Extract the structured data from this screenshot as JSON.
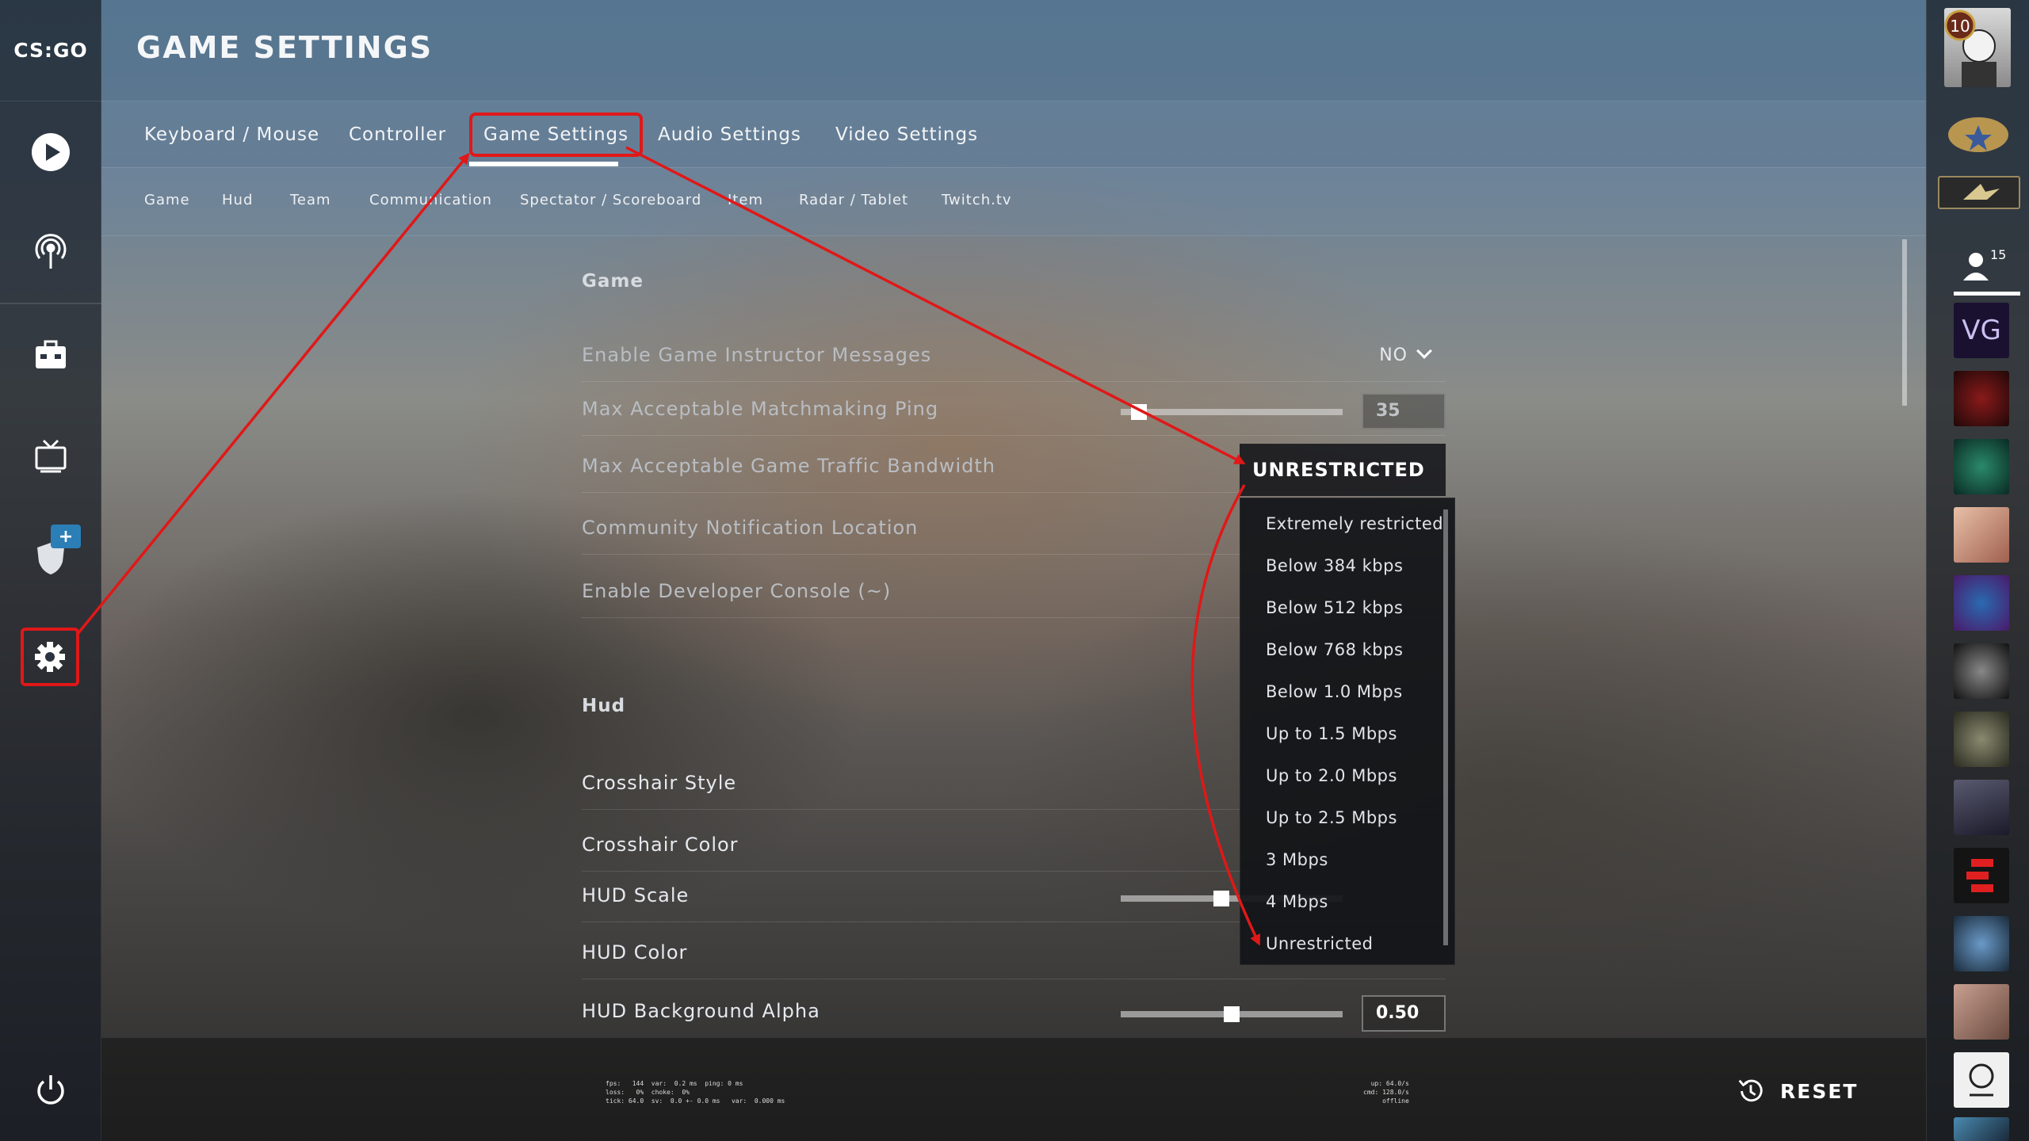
{
  "app": {
    "logo_text": "CS:GO",
    "page_title": "GAME SETTINGS"
  },
  "sidebar": {
    "items": [
      {
        "name": "play",
        "icon": "play-icon"
      },
      {
        "name": "watch-broadcast",
        "icon": "antenna-icon"
      },
      {
        "name": "inventory",
        "icon": "briefcase-icon"
      },
      {
        "name": "tv",
        "icon": "tv-icon"
      },
      {
        "name": "operations",
        "icon": "shield-icon",
        "badge": "+"
      },
      {
        "name": "settings",
        "icon": "gear-icon"
      }
    ],
    "power_icon": "power-icon"
  },
  "tabs": [
    {
      "label": "Keyboard / Mouse"
    },
    {
      "label": "Controller"
    },
    {
      "label": "Game Settings",
      "active": true
    },
    {
      "label": "Audio Settings"
    },
    {
      "label": "Video Settings"
    }
  ],
  "subtabs": [
    "Game",
    "Hud",
    "Team",
    "Communication",
    "Spectator / Scoreboard",
    "Item",
    "Radar / Tablet",
    "Twitch.tv"
  ],
  "sections": {
    "game": {
      "title": "Game",
      "rows": {
        "instructor": {
          "label": "Enable Game Instructor Messages",
          "value": "NO"
        },
        "ping": {
          "label": "Max Acceptable Matchmaking Ping",
          "value": "35",
          "slider_fraction": 0.05
        },
        "bandwidth": {
          "label": "Max Acceptable Game Traffic Bandwidth",
          "value": "UNRESTRICTED"
        },
        "community": {
          "label": "Community Notification Location"
        },
        "console": {
          "label": "Enable Developer Console (~)"
        }
      }
    },
    "hud": {
      "title": "Hud",
      "rows": {
        "crosshair_style": {
          "label": "Crosshair Style"
        },
        "crosshair_color": {
          "label": "Crosshair Color"
        },
        "hud_scale": {
          "label": "HUD Scale",
          "slider_fraction": 0.45
        },
        "hud_color": {
          "label": "HUD Color"
        },
        "hud_alpha": {
          "label": "HUD Background Alpha",
          "value": "0.50",
          "slider_fraction": 0.5
        }
      }
    }
  },
  "bandwidth_dropdown": {
    "options": [
      "Extremely restricted",
      "Below 384 kbps",
      "Below 512 kbps",
      "Below 768 kbps",
      "Below 1.0 Mbps",
      "Up to 1.5 Mbps",
      "Up to 2.0 Mbps",
      "Up to 2.5 Mbps",
      "3 Mbps",
      "4 Mbps",
      "Unrestricted"
    ]
  },
  "right_panel": {
    "rank_level": "10",
    "friends_count": "15"
  },
  "footer": {
    "reset_label": "RESET",
    "netgraph_left": "fps:   144  var:  0.2 ms  ping: 0 ms\nloss:   0%  choke:  0%\ntick: 64.0  sv:  0.0 +- 0.0 ms   var:  0.000 ms",
    "netgraph_right": "up: 64.0/s\ncmd: 128.0/s\noffline"
  },
  "colors": {
    "highlight": "#e01818",
    "accent_blue": "#2b7fb6"
  }
}
